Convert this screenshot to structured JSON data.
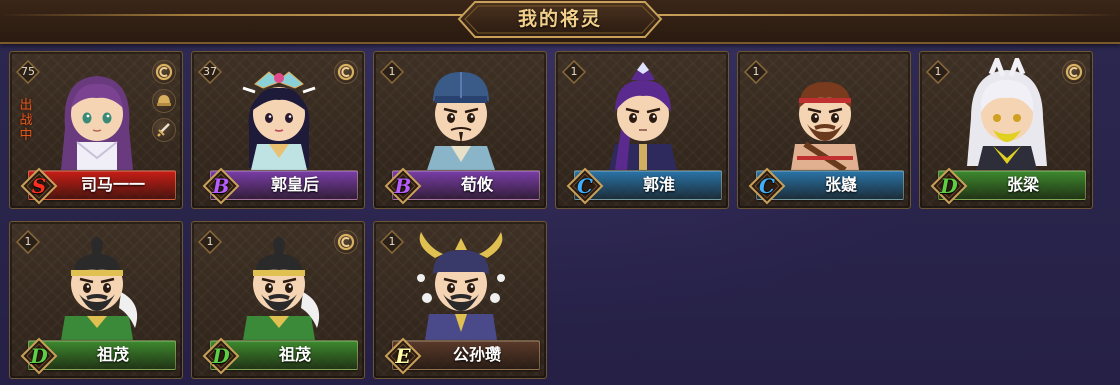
{
  "header": {
    "title": "我的将灵"
  },
  "colors": {
    "S": "#c81e16",
    "B": "#7a3ea8",
    "C": "#2a74a8",
    "D": "#3d8a2e",
    "E": "#5a3a2a"
  },
  "cards": [
    {
      "level": "75",
      "grade": "S",
      "name": "司马一一",
      "deployed": true,
      "deploy_label": "出战中",
      "icons": [
        "coin-icon",
        "helmet-icon",
        "sword-icon"
      ],
      "avatar": "purple-hair-girl"
    },
    {
      "level": "37",
      "grade": "B",
      "name": "郭皇后",
      "icons": [
        "coin-icon"
      ],
      "avatar": "empress"
    },
    {
      "level": "1",
      "grade": "B",
      "name": "荀攸",
      "icons": [],
      "avatar": "scholar"
    },
    {
      "level": "1",
      "grade": "C",
      "name": "郭淮",
      "icons": [],
      "avatar": "purple-warrior"
    },
    {
      "level": "1",
      "grade": "C",
      "name": "张嶷",
      "icons": [],
      "avatar": "bearded-brawler"
    },
    {
      "level": "1",
      "grade": "D",
      "name": "张梁",
      "icons": [
        "coin-icon"
      ],
      "avatar": "white-hair-mystic"
    },
    {
      "level": "1",
      "grade": "D",
      "name": "祖茂",
      "icons": [],
      "avatar": "headband-general"
    },
    {
      "level": "1",
      "grade": "D",
      "name": "祖茂",
      "icons": [
        "coin-icon"
      ],
      "avatar": "headband-general"
    },
    {
      "level": "1",
      "grade": "E",
      "name": "公孙瓒",
      "icons": [],
      "avatar": "horned-general"
    }
  ]
}
